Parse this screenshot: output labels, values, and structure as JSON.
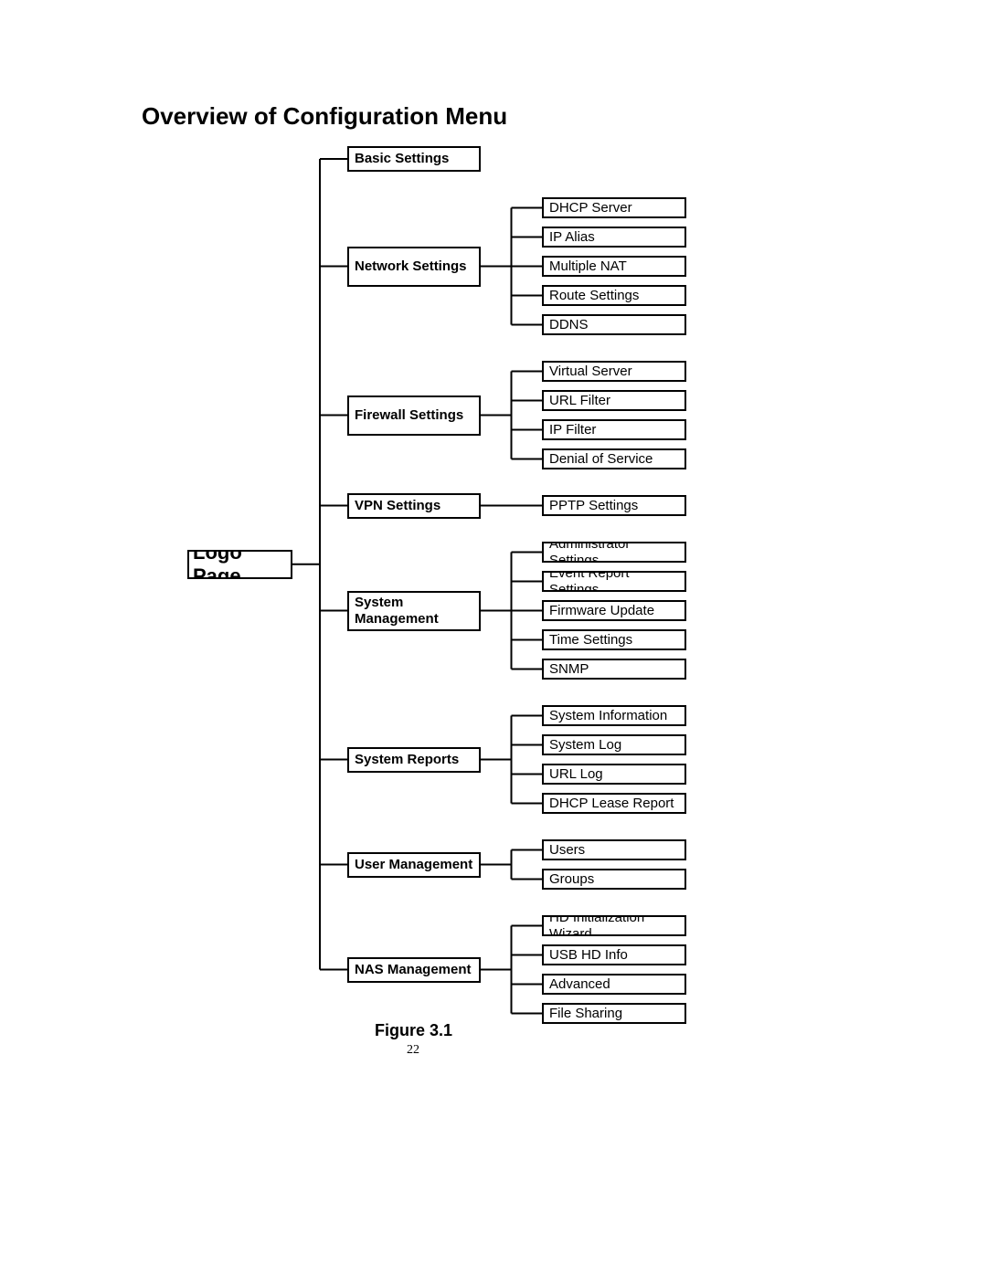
{
  "heading": "Overview of Configuration Menu",
  "caption": "Figure 3.1",
  "page_number": "22",
  "root": "Logo Page",
  "categories": [
    {
      "label": "Basic Settings",
      "subs": []
    },
    {
      "label": "Network Settings",
      "subs": [
        "DHCP Server",
        "IP Alias",
        "Multiple NAT",
        "Route Settings",
        "DDNS"
      ]
    },
    {
      "label": "Firewall Settings",
      "subs": [
        "Virtual Server",
        "URL Filter",
        "IP Filter",
        "Denial of Service"
      ]
    },
    {
      "label": "VPN Settings",
      "subs": [
        "PPTP Settings"
      ]
    },
    {
      "label": "System Management",
      "subs": [
        "Administrator Settings",
        "Event Report Settings",
        "Firmware Update",
        "Time Settings",
        "SNMP"
      ]
    },
    {
      "label": "System Reports",
      "subs": [
        "System Information",
        "System Log",
        "URL Log",
        "DHCP Lease Report"
      ]
    },
    {
      "label": "User Management",
      "subs": [
        "Users",
        "Groups"
      ]
    },
    {
      "label": "NAS Management",
      "subs": [
        "HD Initialization Wizard",
        "USB HD Info",
        "Advanced",
        "File Sharing"
      ]
    }
  ]
}
